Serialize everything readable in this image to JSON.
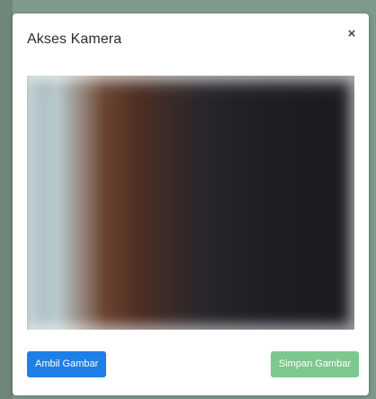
{
  "modal": {
    "title": "Akses Kamera",
    "close_label": "×"
  },
  "camera": {
    "preview_label": "camera preview"
  },
  "footer": {
    "capture_label": "Ambil Gambar",
    "save_label": "Simpan Gambar"
  },
  "colors": {
    "backdrop": "#7f9a8b",
    "primary": "#1e7fe6",
    "success": "#7dc88e"
  },
  "icons": {
    "close": "close-icon"
  }
}
